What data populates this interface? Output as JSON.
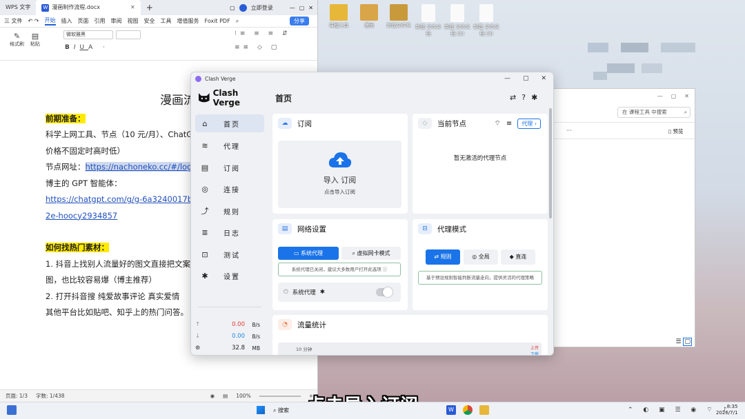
{
  "desktop": {
    "icons": [
      {
        "label": "课程工具"
      },
      {
        "label": "漫画"
      },
      {
        "label": "新建文件夹"
      },
      {
        "label": "新建 文本文档"
      },
      {
        "label": "新建 文本文档 (2)"
      },
      {
        "label": "新建 文本文档 (3)"
      }
    ]
  },
  "wps": {
    "tabs": [
      "WPS 文字",
      "漫画制作流程.docx"
    ],
    "login": "立即登录",
    "menu": [
      "三 文件",
      "开始",
      "插入",
      "页面",
      "引用",
      "审阅",
      "视图",
      "安全",
      "工具",
      "增值服务",
      "Foxit PDF"
    ],
    "share": "分享",
    "ribbon": {
      "format_painter": "格式刷",
      "paste": "粘贴",
      "font": "微软雅黑"
    },
    "doc": {
      "title": "漫画流程讲解",
      "sec1": "前期准备：",
      "p1a": "科学上网工具、节点（10 元/月）、ChatG",
      "p1b": "价格不固定时高时低）",
      "p2_label": "节点网址：",
      "p2_link": "https://nachoneko.cc/#/login",
      "p3": "博主的 GPT 智能体：",
      "p4a": "https://chatgpt.com/g/g-6a3240017b6",
      "p4b": "2e-hoocy2934857",
      "sec2": "如何找热门素材：",
      "p5a": "1. 抖音上找别人流量好的图文直接把文案抄",
      "p5b": "图，也比较容易爆（博主推荐）",
      "p6": "2. 打开抖音搜   纯爱故事评论     真实爱情",
      "p7": "其他平台比如贴吧、知乎上的热门问答。"
    },
    "status": {
      "page": "页面: 1/3",
      "words": "字数: 1/438",
      "zoom": "100%"
    }
  },
  "explorer": {
    "search_placeholder": "在 课程工具 中搜索",
    "preview": "预览"
  },
  "clash": {
    "window_title": "Clash Verge",
    "brand": "Clash Verge",
    "page_title": "首页",
    "nav": [
      {
        "label": "首页",
        "icon": "⌂"
      },
      {
        "label": "代理",
        "icon": "≋"
      },
      {
        "label": "订阅",
        "icon": "▤"
      },
      {
        "label": "连接",
        "icon": "◎"
      },
      {
        "label": "规则",
        "icon": "⤴"
      },
      {
        "label": "日志",
        "icon": "≣"
      },
      {
        "label": "测试",
        "icon": "⊡"
      },
      {
        "label": "设置",
        "icon": "✱"
      }
    ],
    "traffic": {
      "up": "0.00",
      "up_unit": "B/s",
      "down": "0.00",
      "down_unit": "B/s",
      "mem": "32.8",
      "mem_unit": "MB"
    },
    "subscription": {
      "title": "订阅",
      "import": "导入 订阅",
      "hint": "点击导入订阅"
    },
    "current_node": {
      "title": "当前节点",
      "proxy_btn": "代理",
      "empty": "暂无激活的代理节点"
    },
    "network": {
      "title": "网络设置",
      "tab_system": "系统代理",
      "tab_tun": "虚拟网卡模式",
      "notice": "系统代理已关闭，建议大多数用户打开此选项",
      "toggle_label": "系统代理"
    },
    "proxy_mode": {
      "title": "代理模式",
      "modes": [
        "规则",
        "全局",
        "直连"
      ],
      "desc": "基于预设规则智能判断流量走向，提供灵活的代理策略"
    },
    "traffic_stats": {
      "title": "流量统计",
      "range": "10 分钟",
      "up_legend": "上传",
      "down_legend": "下载"
    }
  },
  "taskbar": {
    "search": "搜索",
    "time": "8:35",
    "date": "2026/7/1"
  },
  "caption": "点击导入订阅",
  "colors": {
    "accent": "#1a73e8",
    "upload": "#e53935",
    "download": "#1e88e5"
  }
}
